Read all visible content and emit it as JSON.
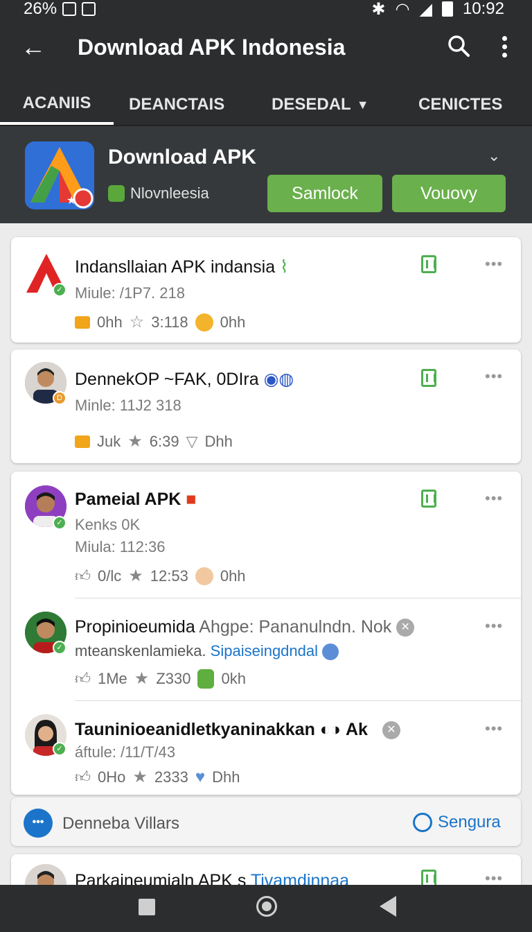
{
  "status_bar": {
    "battery_percent": "26%",
    "time": "10:92"
  },
  "app_bar": {
    "title": "Download APK Indonesia",
    "icons": [
      "back-arrow-icon",
      "search-icon",
      "more-vert-icon"
    ]
  },
  "tabs": [
    {
      "label": "ACANIIS",
      "active": true
    },
    {
      "label": "DEANCTAIS",
      "active": false
    },
    {
      "label": "DESEDAL",
      "active": false,
      "dropdown": true
    },
    {
      "label": "CENICTES",
      "active": false
    }
  ],
  "hero": {
    "app_name": "Download APK",
    "developer": "Nlovnleesia",
    "buttons": [
      "Samlock",
      "Vouovy"
    ]
  },
  "items": [
    {
      "title": "Indansllaian APK indansia",
      "line1": "Miule: /1P7. 218",
      "stats": {
        "likes": "0hh",
        "rating": "3:118",
        "extra": "0hh"
      }
    },
    {
      "title": "DennekOP ~FAK, 0DIra",
      "line1": "Minle: 11J2 318",
      "stats": {
        "likes": "Juk",
        "rating": "6:39",
        "extra": "Dhh"
      }
    },
    {
      "title": "Pameial APK",
      "line1": "Kenks 0K",
      "line2": "Miula: 112:36",
      "stats": {
        "likes": "0/lc",
        "rating": "12:53",
        "extra": "0hh"
      }
    },
    {
      "title_bold": "Propinioeumida",
      "title_rest": "Ahgpe: Pananulndn. Nok",
      "line1": "mteanskenlamieka.",
      "line1_link": "Sipaiseingdndal",
      "stats": {
        "likes": "1Me",
        "rating": "Z330",
        "extra": "0kh"
      }
    },
    {
      "title_bold": "Tauninioeanidletkyaninakkan",
      "title_rest": "Ak",
      "line1": "áftule: /11/T/43",
      "stats": {
        "likes": "0Ho",
        "rating": "2333",
        "extra": "Dhh"
      }
    },
    {
      "title": "Parkaineumialn APK s",
      "title_link": "Tivamdinnaa"
    }
  ],
  "bottom_bar": {
    "label": "Denneba Villars",
    "action": "Sengura"
  },
  "colors": {
    "bar_dark": "#2b2d2f",
    "accent_green": "#6ab04c",
    "link_blue": "#1b74c9"
  }
}
